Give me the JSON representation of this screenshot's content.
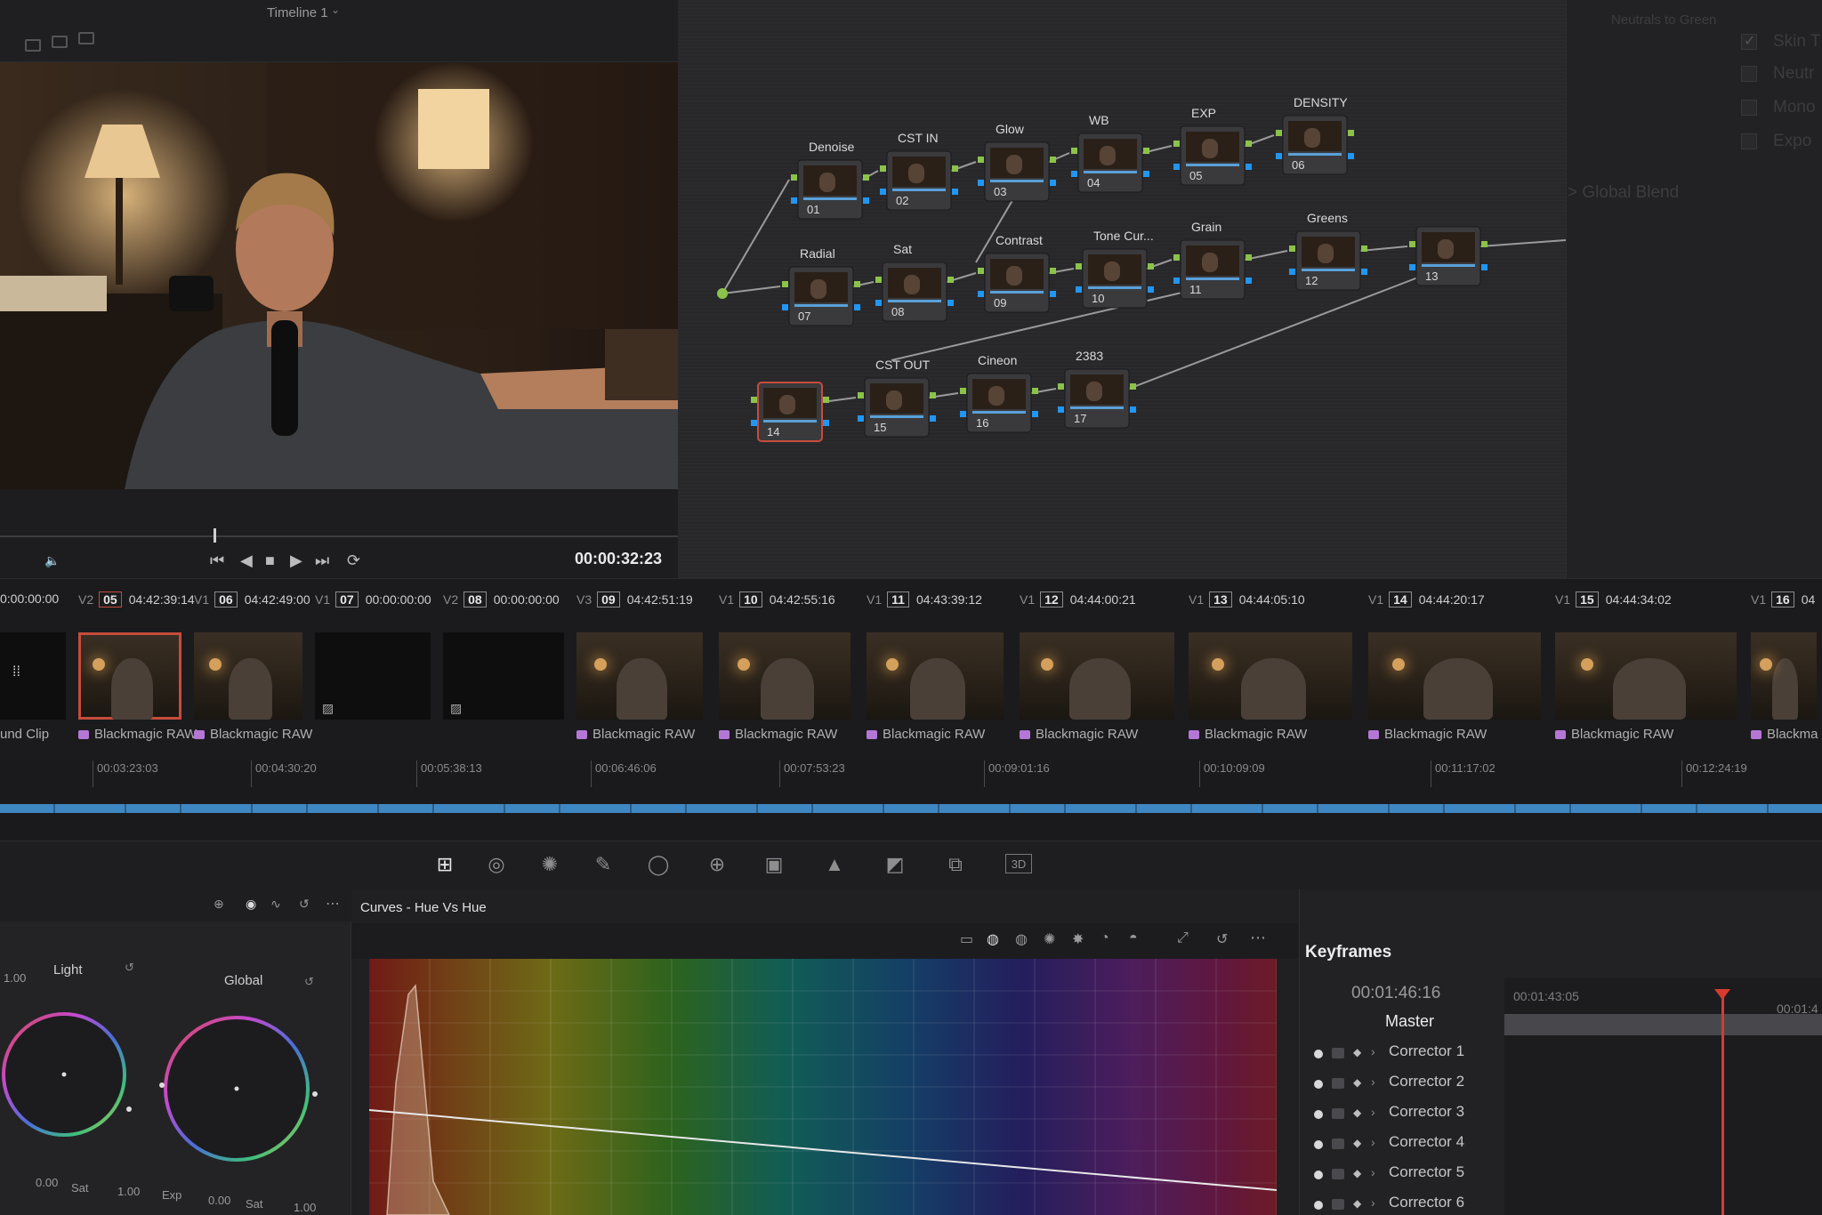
{
  "viewer": {
    "timeline_title": "Timeline 1",
    "timecode": "00:00:32:23"
  },
  "node_graph": {
    "nodes": [
      {
        "label": "Denoise",
        "number": "01"
      },
      {
        "label": "CST IN",
        "number": "02"
      },
      {
        "label": "Glow",
        "number": "03"
      },
      {
        "label": "WB",
        "number": "04"
      },
      {
        "label": "EXP",
        "number": "05"
      },
      {
        "label": "DENSITY",
        "number": "06"
      },
      {
        "label": "Radial",
        "number": "07"
      },
      {
        "label": "Sat",
        "number": "08"
      },
      {
        "label": "Contrast",
        "number": "09"
      },
      {
        "label": "Tone Cur...",
        "number": "10"
      },
      {
        "label": "Grain",
        "number": "11"
      },
      {
        "label": "Greens",
        "number": "12"
      },
      {
        "label": "",
        "number": "13"
      },
      {
        "label": "",
        "number": "14"
      },
      {
        "label": "CST OUT",
        "number": "15"
      },
      {
        "label": "Cineon",
        "number": "16"
      },
      {
        "label": "2383",
        "number": "17"
      }
    ]
  },
  "right_panel": {
    "heading": "Neutrals to Green",
    "rows": [
      "Skin T",
      "Neutr",
      "Mono",
      "Expo"
    ],
    "global_blend": "Global Blend"
  },
  "clips": [
    {
      "track": "",
      "number": "",
      "timecode": "0:00:00:00",
      "name": "und Clip",
      "selected": false
    },
    {
      "track": "V2",
      "number": "05",
      "timecode": "04:42:39:14",
      "name": "Blackmagic RAW",
      "selected": true
    },
    {
      "track": "V1",
      "number": "06",
      "timecode": "04:42:49:00",
      "name": "Blackmagic RAW",
      "selected": false
    },
    {
      "track": "V1",
      "number": "07",
      "timecode": "00:00:00:00",
      "name": "",
      "selected": false
    },
    {
      "track": "V2",
      "number": "08",
      "timecode": "00:00:00:00",
      "name": "",
      "selected": false
    },
    {
      "track": "V3",
      "number": "09",
      "timecode": "04:42:51:19",
      "name": "Blackmagic RAW",
      "selected": false
    },
    {
      "track": "V1",
      "number": "10",
      "timecode": "04:42:55:16",
      "name": "Blackmagic RAW",
      "selected": false
    },
    {
      "track": "V1",
      "number": "11",
      "timecode": "04:43:39:12",
      "name": "Blackmagic RAW",
      "selected": false
    },
    {
      "track": "V1",
      "number": "12",
      "timecode": "04:44:00:21",
      "name": "Blackmagic RAW",
      "selected": false
    },
    {
      "track": "V1",
      "number": "13",
      "timecode": "04:44:05:10",
      "name": "Blackmagic RAW",
      "selected": false
    },
    {
      "track": "V1",
      "number": "14",
      "timecode": "04:44:20:17",
      "name": "Blackmagic RAW",
      "selected": false
    },
    {
      "track": "V1",
      "number": "15",
      "timecode": "04:44:34:02",
      "name": "Blackmagic RAW",
      "selected": false
    },
    {
      "track": "V1",
      "number": "16",
      "timecode": "04",
      "name": "Blackma",
      "selected": false
    }
  ],
  "ruler": [
    "00:03:23:03",
    "00:04:30:20",
    "00:05:38:13",
    "00:06:46:06",
    "00:07:53:23",
    "00:09:01:16",
    "00:10:09:09",
    "00:11:17:02",
    "00:12:24:19"
  ],
  "curves": {
    "title": "Curves - Hue Vs Hue"
  },
  "wheels": {
    "light_label": "Light",
    "global_label": "Global",
    "light_values": [
      "0.00",
      "1.00"
    ],
    "light_sat": "Sat",
    "global_exp": "Exp",
    "global_values": [
      "0.00",
      "1.00"
    ],
    "global_sat": "Sat",
    "left_scale": "1.00"
  },
  "keyframes": {
    "title": "Keyframes",
    "timecode": "00:01:46:16",
    "ruler_start": "00:01:43:05",
    "ruler_end": "00:01:4",
    "master": "Master",
    "rows": [
      "Corrector 1",
      "Corrector 2",
      "Corrector 3",
      "Corrector 4",
      "Corrector 5",
      "Corrector 6"
    ]
  },
  "colors": {
    "selected_outline": "#c64c3c",
    "rgb_link": "#8bc34a",
    "alpha_link": "#2196f3",
    "playhead": "#d63b2f",
    "clip_band": "#3f87c2"
  }
}
